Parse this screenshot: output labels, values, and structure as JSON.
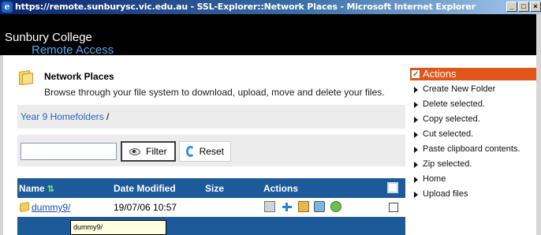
{
  "window": {
    "title": "https://remote.sunburysc.vic.edu.au - SSL-Explorer::Network Places - Microsoft Internet Explorer",
    "controls": [
      "_",
      "□",
      "×"
    ]
  },
  "brand": {
    "line1": "Sunbury College",
    "line2": "Remote Access"
  },
  "page": {
    "title": "Network Places",
    "description": "Browse through your file system to download, upload, move and delete your files.",
    "icon": "folder-icon"
  },
  "breadcrumb": {
    "link": "Year 9 Homefolders",
    "separator": "/"
  },
  "filter": {
    "input_value": "",
    "filter_label": "Filter",
    "reset_label": "Reset"
  },
  "table": {
    "columns": [
      "Name",
      "Date Modified",
      "Size",
      "Actions"
    ],
    "rows": [
      {
        "name": "dummy9/",
        "date": "19/07/06 10:57",
        "size": ""
      }
    ],
    "row_actions": [
      "copy-icon",
      "move-icon",
      "paste-icon",
      "download-icon",
      "zip-icon"
    ]
  },
  "tooltip": "dummy9/",
  "actions_panel": {
    "title": "Actions",
    "items": [
      "Create New Folder",
      "Delete selected.",
      "Copy selected.",
      "Cut selected.",
      "Paste clipboard contents.",
      "Zip selected.",
      "Home",
      "Upload files"
    ]
  },
  "colors": {
    "header_bg": "#000000",
    "brand_accent": "#5aa9ee",
    "table_header": "#1d5a99",
    "actions_header": "#e0551a"
  }
}
